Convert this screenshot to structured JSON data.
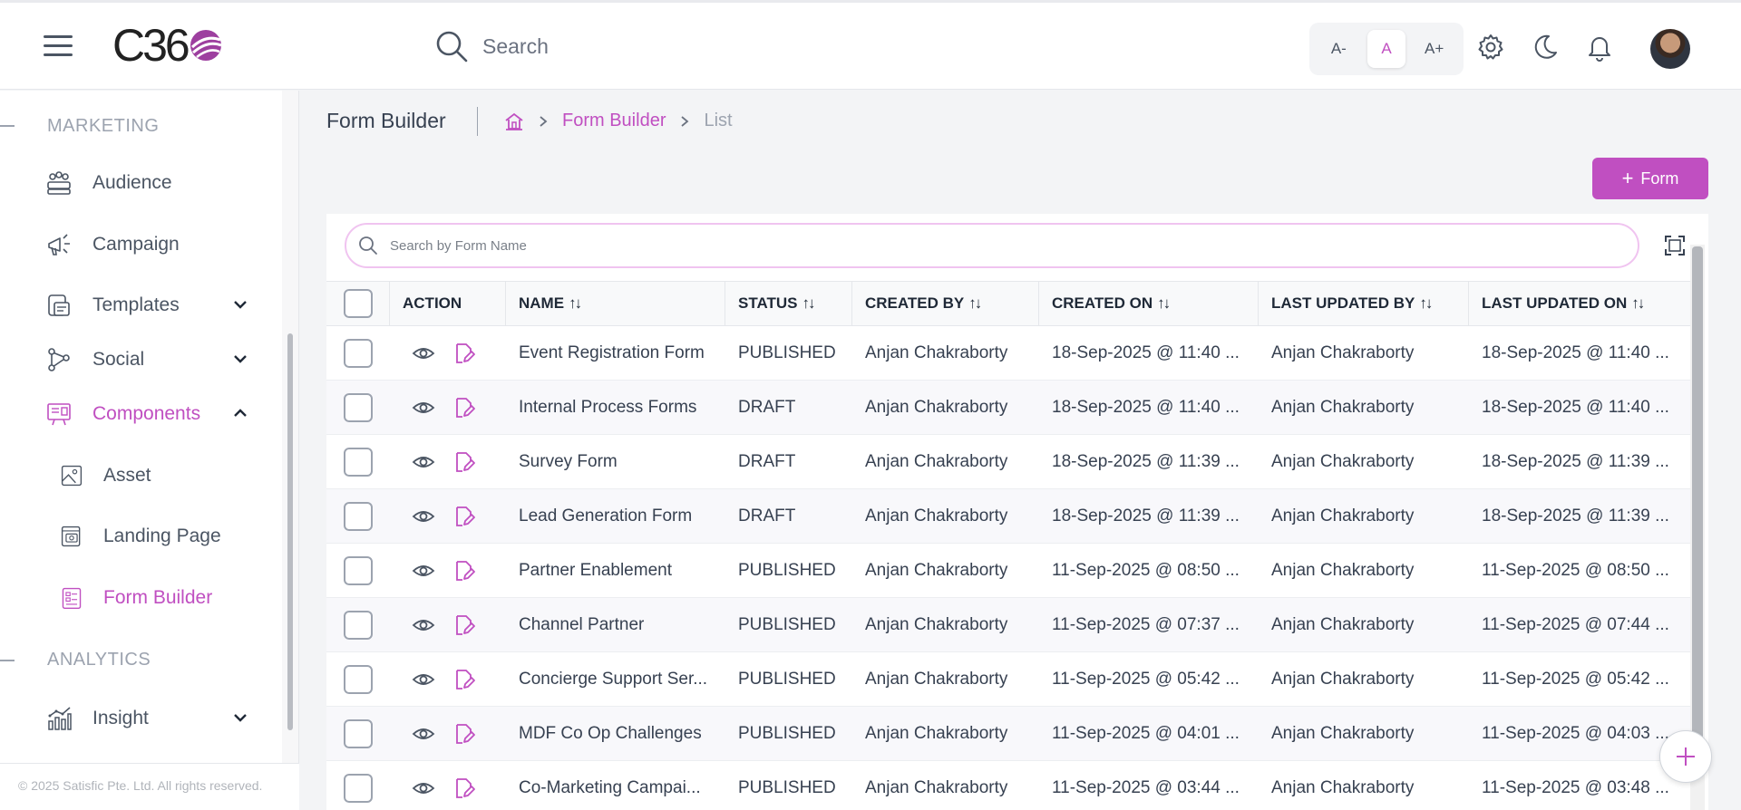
{
  "header": {
    "logo_text": "C36",
    "search_placeholder": "Search",
    "font_small": "A-",
    "font_normal": "A",
    "font_large": "A+"
  },
  "sidebar": {
    "section_marketing": "MARKETING",
    "section_analytics": "ANALYTICS",
    "items": {
      "audience": "Audience",
      "campaign": "Campaign",
      "templates": "Templates",
      "social": "Social",
      "components": "Components",
      "asset": "Asset",
      "landing_page": "Landing Page",
      "form_builder": "Form Builder",
      "insight": "Insight"
    },
    "footer": "© 2025 Satisfic Pte. Ltd. All rights reserved."
  },
  "page": {
    "title": "Form Builder",
    "breadcrumb_link": "Form Builder",
    "breadcrumb_current": "List",
    "add_button": "Form",
    "table_search_placeholder": "Search by Form Name"
  },
  "table": {
    "columns": {
      "action": "ACTION",
      "name": "NAME",
      "status": "STATUS",
      "created_by": "CREATED BY",
      "created_on": "CREATED ON",
      "last_updated_by": "LAST UPDATED BY",
      "last_updated_on": "LAST UPDATED ON"
    },
    "sort_glyph": "↑↓",
    "rows": [
      {
        "name": "Event Registration Form",
        "status": "PUBLISHED",
        "created_by": "Anjan Chakraborty",
        "created_on": "18-Sep-2025 @ 11:40 ...",
        "updated_by": "Anjan Chakraborty",
        "updated_on": "18-Sep-2025 @ 11:40 ..."
      },
      {
        "name": "Internal Process Forms",
        "status": "DRAFT",
        "created_by": "Anjan Chakraborty",
        "created_on": "18-Sep-2025 @ 11:40 ...",
        "updated_by": "Anjan Chakraborty",
        "updated_on": "18-Sep-2025 @ 11:40 ..."
      },
      {
        "name": "Survey Form",
        "status": "DRAFT",
        "created_by": "Anjan Chakraborty",
        "created_on": "18-Sep-2025 @ 11:39 ...",
        "updated_by": "Anjan Chakraborty",
        "updated_on": "18-Sep-2025 @ 11:39 ..."
      },
      {
        "name": "Lead Generation Form",
        "status": "DRAFT",
        "created_by": "Anjan Chakraborty",
        "created_on": "18-Sep-2025 @ 11:39 ...",
        "updated_by": "Anjan Chakraborty",
        "updated_on": "18-Sep-2025 @ 11:39 ..."
      },
      {
        "name": "Partner Enablement",
        "status": "PUBLISHED",
        "created_by": "Anjan Chakraborty",
        "created_on": "11-Sep-2025 @ 08:50 ...",
        "updated_by": "Anjan Chakraborty",
        "updated_on": "11-Sep-2025 @ 08:50 ..."
      },
      {
        "name": "Channel Partner",
        "status": "PUBLISHED",
        "created_by": "Anjan Chakraborty",
        "created_on": "11-Sep-2025 @ 07:37 ...",
        "updated_by": "Anjan Chakraborty",
        "updated_on": "11-Sep-2025 @ 07:44 ..."
      },
      {
        "name": "Concierge Support Ser...",
        "status": "PUBLISHED",
        "created_by": "Anjan Chakraborty",
        "created_on": "11-Sep-2025 @ 05:42 ...",
        "updated_by": "Anjan Chakraborty",
        "updated_on": "11-Sep-2025 @ 05:42 ..."
      },
      {
        "name": "MDF Co Op Challenges",
        "status": "PUBLISHED",
        "created_by": "Anjan Chakraborty",
        "created_on": "11-Sep-2025 @ 04:01 ...",
        "updated_by": "Anjan Chakraborty",
        "updated_on": "11-Sep-2025 @ 04:03 ..."
      },
      {
        "name": "Co-Marketing Campai...",
        "status": "PUBLISHED",
        "created_by": "Anjan Chakraborty",
        "created_on": "11-Sep-2025 @ 03:44 ...",
        "updated_by": "Anjan Chakraborty",
        "updated_on": "11-Sep-2025 @ 03:48 ..."
      }
    ]
  },
  "colors": {
    "accent": "#c04fc1",
    "muted": "#9ca3af"
  }
}
